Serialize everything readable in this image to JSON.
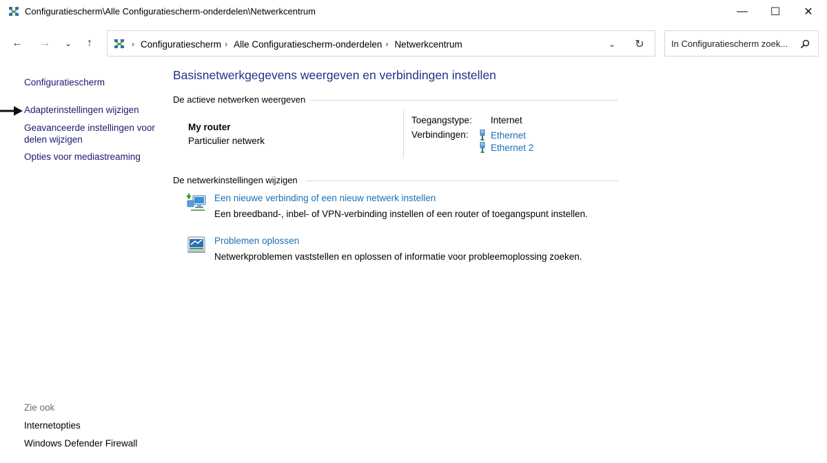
{
  "window": {
    "title": "Configuratiescherm\\Alle Configuratiescherm-onderdelen\\Netwerkcentrum",
    "minimize_glyph": "—",
    "maximize_glyph": "☐",
    "close_glyph": "✕"
  },
  "nav": {
    "back_glyph": "←",
    "forward_glyph": "→",
    "history_glyph": "⌄",
    "up_glyph": "↑",
    "breadcrumbs": [
      "Configuratiescherm",
      "Alle Configuratiescherm-onderdelen",
      "Netwerkcentrum"
    ],
    "breadcrumb_sep": "›",
    "dropdown_glyph": "⌄",
    "refresh_glyph": "↻",
    "search_placeholder": "In Configuratiescherm zoek...",
    "search_glyph": "⚲"
  },
  "sidebar": {
    "home_label": "Configuratiescherm",
    "links": [
      "Adapterinstellingen wijzigen",
      "Geavanceerde instellingen voor",
      "delen wijzigen",
      "Opties voor mediastreaming"
    ],
    "see_also_label": "Zie ook",
    "see_also_links": [
      "Internetopties",
      "Windows Defender Firewall"
    ]
  },
  "main": {
    "title": "Basisnetwerkgegevens weergeven en verbindingen instellen",
    "active_section": "De actieve netwerken weergeven",
    "network": {
      "name": "My router",
      "type": "Particulier netwerk",
      "access_label": "Toegangstype:",
      "access_value": "Internet",
      "connections_label": "Verbindingen:",
      "connections": [
        "Ethernet",
        "Ethernet 2"
      ]
    },
    "change_section": "De netwerkinstellingen wijzigen",
    "tasks": [
      {
        "link": "Een nieuwe verbinding of een nieuw netwerk instellen",
        "description": "Een breedband-, inbel- of VPN-verbinding instellen of een router of toegangspunt instellen."
      },
      {
        "link": "Problemen oplossen",
        "description": "Netwerkproblemen vaststellen en oplossen of informatie voor probleemoplossing zoeken."
      }
    ]
  },
  "colors": {
    "title_blue": "#1e3287",
    "link_blue": "#1a6fb5",
    "nav_link": "#1a1a6e",
    "divider": "#d9d9d9"
  }
}
